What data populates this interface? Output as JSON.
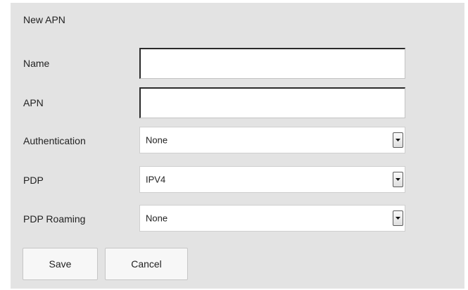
{
  "dialog": {
    "title": "New APN"
  },
  "fields": {
    "name": {
      "label": "Name",
      "value": ""
    },
    "apn": {
      "label": "APN",
      "value": ""
    },
    "authentication": {
      "label": "Authentication",
      "selected": "None"
    },
    "pdp": {
      "label": "PDP",
      "selected": "IPV4"
    },
    "pdp_roaming": {
      "label": "PDP Roaming",
      "selected": "None"
    }
  },
  "buttons": {
    "save_label": "Save",
    "cancel_label": "Cancel"
  },
  "icons": {
    "dropdown": "chevron-down-icon"
  },
  "colors": {
    "panel_background": "#e3e3e3",
    "field_background": "#ffffff",
    "button_background": "#f7f7f7"
  }
}
